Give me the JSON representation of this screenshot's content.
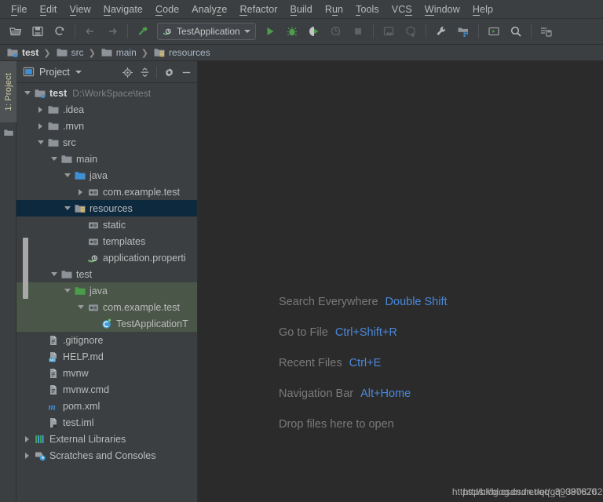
{
  "window": {
    "app": "IntelliJ IDEA",
    "accent_blue": "#4a88dd",
    "selection_blue": "#0d293e",
    "test_source_green": "#4a5748",
    "editor_bg": "#2b2b2b",
    "panel_bg": "#3c3f41"
  },
  "menubar": {
    "items": [
      {
        "label": "File",
        "mnemonic": "F"
      },
      {
        "label": "Edit",
        "mnemonic": "E"
      },
      {
        "label": "View",
        "mnemonic": "V"
      },
      {
        "label": "Navigate",
        "mnemonic": "N"
      },
      {
        "label": "Code",
        "mnemonic": "C"
      },
      {
        "label": "Analyze",
        "mnemonic": "z"
      },
      {
        "label": "Refactor",
        "mnemonic": "R"
      },
      {
        "label": "Build",
        "mnemonic": "B"
      },
      {
        "label": "Run",
        "mnemonic": "u"
      },
      {
        "label": "Tools",
        "mnemonic": "T"
      },
      {
        "label": "VCS",
        "mnemonic": "S"
      },
      {
        "label": "Window",
        "mnemonic": "W"
      },
      {
        "label": "Help",
        "mnemonic": "H"
      }
    ]
  },
  "toolbar": {
    "run_configuration": "TestApplication",
    "buttons": [
      {
        "name": "open-folder-icon",
        "title": "Open"
      },
      {
        "name": "save-all-icon",
        "title": "Save All"
      },
      {
        "name": "sync-refresh-icon",
        "title": "Synchronize"
      },
      {
        "name": "back-arrow-icon",
        "title": "Back"
      },
      {
        "name": "forward-arrow-icon",
        "title": "Forward"
      },
      {
        "name": "build-hammer-icon",
        "title": "Build Project"
      },
      {
        "name": "run-play-icon",
        "title": "Run"
      },
      {
        "name": "debug-bug-icon",
        "title": "Debug"
      },
      {
        "name": "run-coverage-icon",
        "title": "Run with Coverage"
      },
      {
        "name": "profile-icon",
        "title": "Profile"
      },
      {
        "name": "stop-square-icon",
        "title": "Stop"
      },
      {
        "name": "update-project-icon",
        "title": "Update Project"
      },
      {
        "name": "commit-icon",
        "title": "Commit"
      },
      {
        "name": "settings-wrench-icon",
        "title": "Settings"
      },
      {
        "name": "project-structure-icon",
        "title": "Project Structure"
      },
      {
        "name": "terminal-icon",
        "title": "Terminal"
      },
      {
        "name": "search-icon",
        "title": "Search Everywhere"
      },
      {
        "name": "datasource-icon",
        "title": "Database"
      }
    ]
  },
  "breadcrumb": {
    "items": [
      {
        "label": "test",
        "icon": "module-icon",
        "bold": true
      },
      {
        "label": "src",
        "icon": "folder-icon",
        "bold": false
      },
      {
        "label": "main",
        "icon": "folder-icon",
        "bold": false
      },
      {
        "label": "resources",
        "icon": "resources-folder-icon",
        "bold": false
      }
    ],
    "separator": "❯"
  },
  "tool_strip": {
    "project_tab": "1: Project"
  },
  "project_panel": {
    "title": "Project",
    "header_actions": [
      {
        "name": "scroll-from-source-icon",
        "title": "Select Opened File"
      },
      {
        "name": "collapse-all-icon",
        "title": "Collapse All"
      },
      {
        "name": "settings-gear-icon",
        "title": "Options"
      },
      {
        "name": "hide-panel-icon",
        "title": "Hide"
      }
    ],
    "tree": [
      {
        "label": "test",
        "sub": "D:\\WorkSpace\\test",
        "indent": 0,
        "arrow": "open",
        "icon": "module-icon",
        "bold": true,
        "state": "normal"
      },
      {
        "label": ".idea",
        "sub": "",
        "indent": 1,
        "arrow": "closed",
        "icon": "folder-icon",
        "bold": false,
        "state": "normal"
      },
      {
        "label": ".mvn",
        "sub": "",
        "indent": 1,
        "arrow": "closed",
        "icon": "folder-icon",
        "bold": false,
        "state": "normal"
      },
      {
        "label": "src",
        "sub": "",
        "indent": 1,
        "arrow": "open",
        "icon": "folder-icon",
        "bold": false,
        "state": "normal"
      },
      {
        "label": "main",
        "sub": "",
        "indent": 2,
        "arrow": "open",
        "icon": "folder-icon",
        "bold": false,
        "state": "normal"
      },
      {
        "label": "java",
        "sub": "",
        "indent": 3,
        "arrow": "open",
        "icon": "source-root-icon",
        "bold": false,
        "state": "normal"
      },
      {
        "label": "com.example.test",
        "sub": "",
        "indent": 4,
        "arrow": "closed",
        "icon": "package-icon",
        "bold": false,
        "state": "normal"
      },
      {
        "label": "resources",
        "sub": "",
        "indent": 3,
        "arrow": "open",
        "icon": "resources-folder-icon",
        "bold": false,
        "state": "selected"
      },
      {
        "label": "static",
        "sub": "",
        "indent": 4,
        "arrow": "none",
        "icon": "package-icon",
        "bold": false,
        "state": "normal"
      },
      {
        "label": "templates",
        "sub": "",
        "indent": 4,
        "arrow": "none",
        "icon": "package-icon",
        "bold": false,
        "state": "normal"
      },
      {
        "label": "application.properti",
        "sub": "",
        "indent": 4,
        "arrow": "none",
        "icon": "spring-properties-icon",
        "bold": false,
        "state": "normal"
      },
      {
        "label": "test",
        "sub": "",
        "indent": 2,
        "arrow": "open",
        "icon": "folder-icon",
        "bold": false,
        "state": "normal"
      },
      {
        "label": "java",
        "sub": "",
        "indent": 3,
        "arrow": "open",
        "icon": "test-source-root-icon",
        "bold": false,
        "state": "green"
      },
      {
        "label": "com.example.test",
        "sub": "",
        "indent": 4,
        "arrow": "open",
        "icon": "package-icon",
        "bold": false,
        "state": "green"
      },
      {
        "label": "TestApplicationT",
        "sub": "",
        "indent": 5,
        "arrow": "none",
        "icon": "java-test-class-icon",
        "bold": false,
        "state": "green"
      },
      {
        "label": ".gitignore",
        "sub": "",
        "indent": 1,
        "arrow": "none",
        "icon": "text-file-icon",
        "bold": false,
        "state": "normal"
      },
      {
        "label": "HELP.md",
        "sub": "",
        "indent": 1,
        "arrow": "none",
        "icon": "markdown-file-icon",
        "bold": false,
        "state": "normal"
      },
      {
        "label": "mvnw",
        "sub": "",
        "indent": 1,
        "arrow": "none",
        "icon": "text-file-icon",
        "bold": false,
        "state": "normal"
      },
      {
        "label": "mvnw.cmd",
        "sub": "",
        "indent": 1,
        "arrow": "none",
        "icon": "text-file-icon",
        "bold": false,
        "state": "normal"
      },
      {
        "label": "pom.xml",
        "sub": "",
        "indent": 1,
        "arrow": "none",
        "icon": "maven-file-icon",
        "bold": false,
        "state": "normal"
      },
      {
        "label": "test.iml",
        "sub": "",
        "indent": 1,
        "arrow": "none",
        "icon": "iml-file-icon",
        "bold": false,
        "state": "normal"
      },
      {
        "label": "External Libraries",
        "sub": "",
        "indent": 0,
        "arrow": "closed",
        "icon": "external-libraries-icon",
        "bold": false,
        "state": "normal"
      },
      {
        "label": "Scratches and Consoles",
        "sub": "",
        "indent": 0,
        "arrow": "closed",
        "icon": "scratches-icon",
        "bold": false,
        "state": "normal"
      }
    ]
  },
  "editor": {
    "hints": [
      {
        "label": "Search Everywhere",
        "key": "Double Shift"
      },
      {
        "label": "Go to File",
        "key": "Ctrl+Shift+R"
      },
      {
        "label": "Recent Files",
        "key": "Ctrl+E"
      },
      {
        "label": "Navigation Bar",
        "key": "Alt+Home"
      },
      {
        "label": "Drop files here to open",
        "key": ""
      }
    ],
    "watermark_front": "https://blog.csdn.net/qq_39087620",
    "watermark_back": "https://blog.csdn.net/qq_39087620"
  }
}
